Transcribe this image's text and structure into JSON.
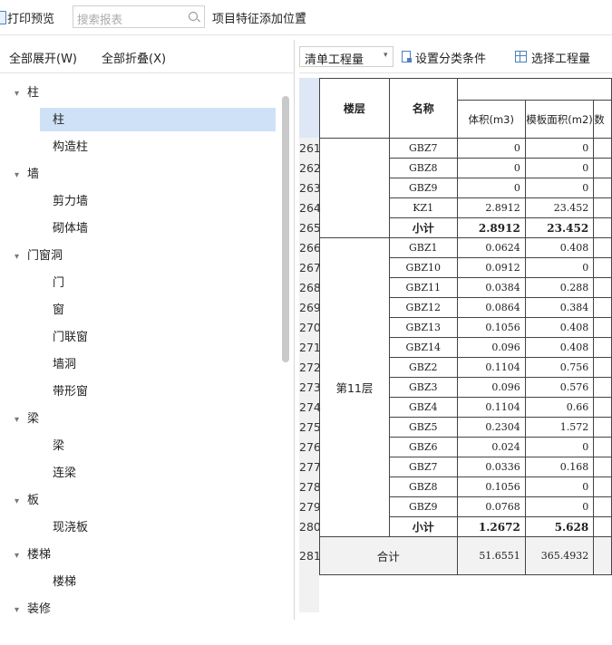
{
  "toolbar": {
    "print_preview": "打印预览",
    "search_placeholder": "搜索报表",
    "project_feature": "项目特征添加位置"
  },
  "left_panel": {
    "expand_all": "全部展开(W)",
    "collapse_all": "全部折叠(X)",
    "tree": [
      {
        "label": "柱",
        "children": [
          "柱",
          "构造柱"
        ]
      },
      {
        "label": "墙",
        "children": [
          "剪力墙",
          "砌体墙"
        ]
      },
      {
        "label": "门窗洞",
        "children": [
          "门",
          "窗",
          "门联窗",
          "墙洞",
          "带形窗"
        ]
      },
      {
        "label": "梁",
        "children": [
          "梁",
          "连梁"
        ]
      },
      {
        "label": "板",
        "children": [
          "现浇板"
        ]
      },
      {
        "label": "楼梯",
        "children": [
          "楼梯"
        ]
      },
      {
        "label": "装修",
        "children": []
      }
    ],
    "selected": "柱"
  },
  "right_panel": {
    "qty_dropdown": "清单工程量",
    "set_category": "设置分类条件",
    "select_qty": "选择工程量"
  },
  "table": {
    "headers": {
      "floor": "楼层",
      "name": "名称",
      "volume": "体积(m3)",
      "formwork": "模板面积(m2)",
      "extra": "数"
    },
    "floor_label": "第11层",
    "rows": [
      {
        "no": "261",
        "name": "GBZ7",
        "vol": "0",
        "form": "0"
      },
      {
        "no": "262",
        "name": "GBZ8",
        "vol": "0",
        "form": "0"
      },
      {
        "no": "263",
        "name": "GBZ9",
        "vol": "0",
        "form": "0"
      },
      {
        "no": "264",
        "name": "KZ1",
        "vol": "2.8912",
        "form": "23.452"
      },
      {
        "no": "265",
        "name": "小计",
        "vol": "2.8912",
        "form": "23.452",
        "sub": true
      },
      {
        "no": "266",
        "name": "GBZ1",
        "vol": "0.0624",
        "form": "0.408"
      },
      {
        "no": "267",
        "name": "GBZ10",
        "vol": "0.0912",
        "form": "0"
      },
      {
        "no": "268",
        "name": "GBZ11",
        "vol": "0.0384",
        "form": "0.288"
      },
      {
        "no": "269",
        "name": "GBZ12",
        "vol": "0.0864",
        "form": "0.384"
      },
      {
        "no": "270",
        "name": "GBZ13",
        "vol": "0.1056",
        "form": "0.408"
      },
      {
        "no": "271",
        "name": "GBZ14",
        "vol": "0.096",
        "form": "0.408"
      },
      {
        "no": "272",
        "name": "GBZ2",
        "vol": "0.1104",
        "form": "0.756"
      },
      {
        "no": "273",
        "name": "GBZ3",
        "vol": "0.096",
        "form": "0.576"
      },
      {
        "no": "274",
        "name": "GBZ4",
        "vol": "0.1104",
        "form": "0.66"
      },
      {
        "no": "275",
        "name": "GBZ5",
        "vol": "0.2304",
        "form": "1.572"
      },
      {
        "no": "276",
        "name": "GBZ6",
        "vol": "0.024",
        "form": "0"
      },
      {
        "no": "277",
        "name": "GBZ7",
        "vol": "0.0336",
        "form": "0.168"
      },
      {
        "no": "278",
        "name": "GBZ8",
        "vol": "0.1056",
        "form": "0"
      },
      {
        "no": "279",
        "name": "GBZ9",
        "vol": "0.0768",
        "form": "0"
      },
      {
        "no": "280",
        "name": "小计",
        "vol": "1.2672",
        "form": "5.628",
        "sub": true
      }
    ],
    "total": {
      "no": "281",
      "label": "合计",
      "vol": "51.6551",
      "form": "365.4932"
    }
  }
}
